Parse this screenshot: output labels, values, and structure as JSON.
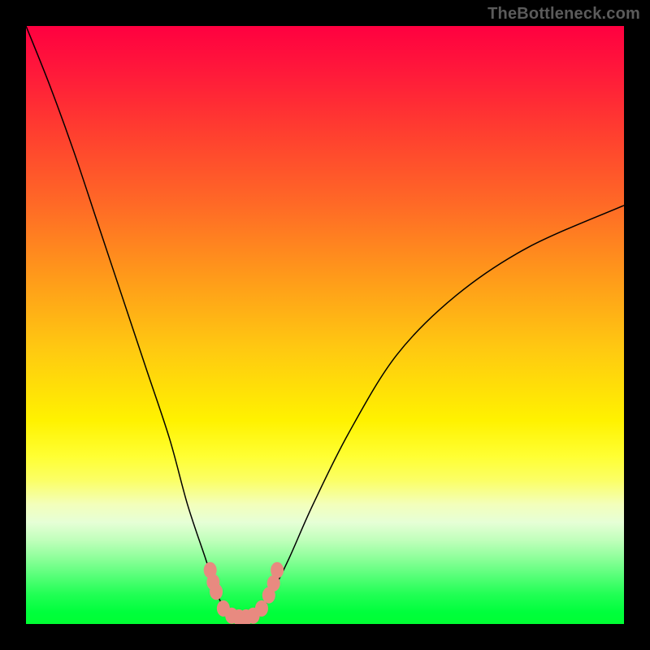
{
  "watermark": "TheBottleneck.com",
  "chart_data": {
    "type": "line",
    "title": "",
    "xlabel": "",
    "ylabel": "",
    "xlim": [
      0,
      100
    ],
    "ylim": [
      0,
      100
    ],
    "grid": false,
    "legend": false,
    "annotations": [],
    "series": [
      {
        "name": "curve",
        "x": [
          0,
          4,
          8,
          12,
          16,
          20,
          24,
          27,
          30,
          32,
          33.5,
          35,
          37,
          39,
          41,
          44,
          48,
          54,
          62,
          72,
          84,
          100
        ],
        "values": [
          100,
          90,
          79,
          67,
          55,
          43,
          31,
          20,
          11,
          5,
          2,
          1,
          1,
          2,
          5,
          11,
          20,
          32,
          45,
          55,
          63,
          70
        ]
      }
    ],
    "markers": [
      {
        "x": 30.8,
        "y": 9.0
      },
      {
        "x": 31.3,
        "y": 7.0
      },
      {
        "x": 31.8,
        "y": 5.4
      },
      {
        "x": 33.0,
        "y": 2.6
      },
      {
        "x": 34.4,
        "y": 1.4
      },
      {
        "x": 35.6,
        "y": 1.1
      },
      {
        "x": 36.8,
        "y": 1.1
      },
      {
        "x": 38.0,
        "y": 1.4
      },
      {
        "x": 39.4,
        "y": 2.6
      },
      {
        "x": 40.6,
        "y": 4.8
      },
      {
        "x": 41.4,
        "y": 6.8
      },
      {
        "x": 42.0,
        "y": 9.0
      }
    ]
  }
}
